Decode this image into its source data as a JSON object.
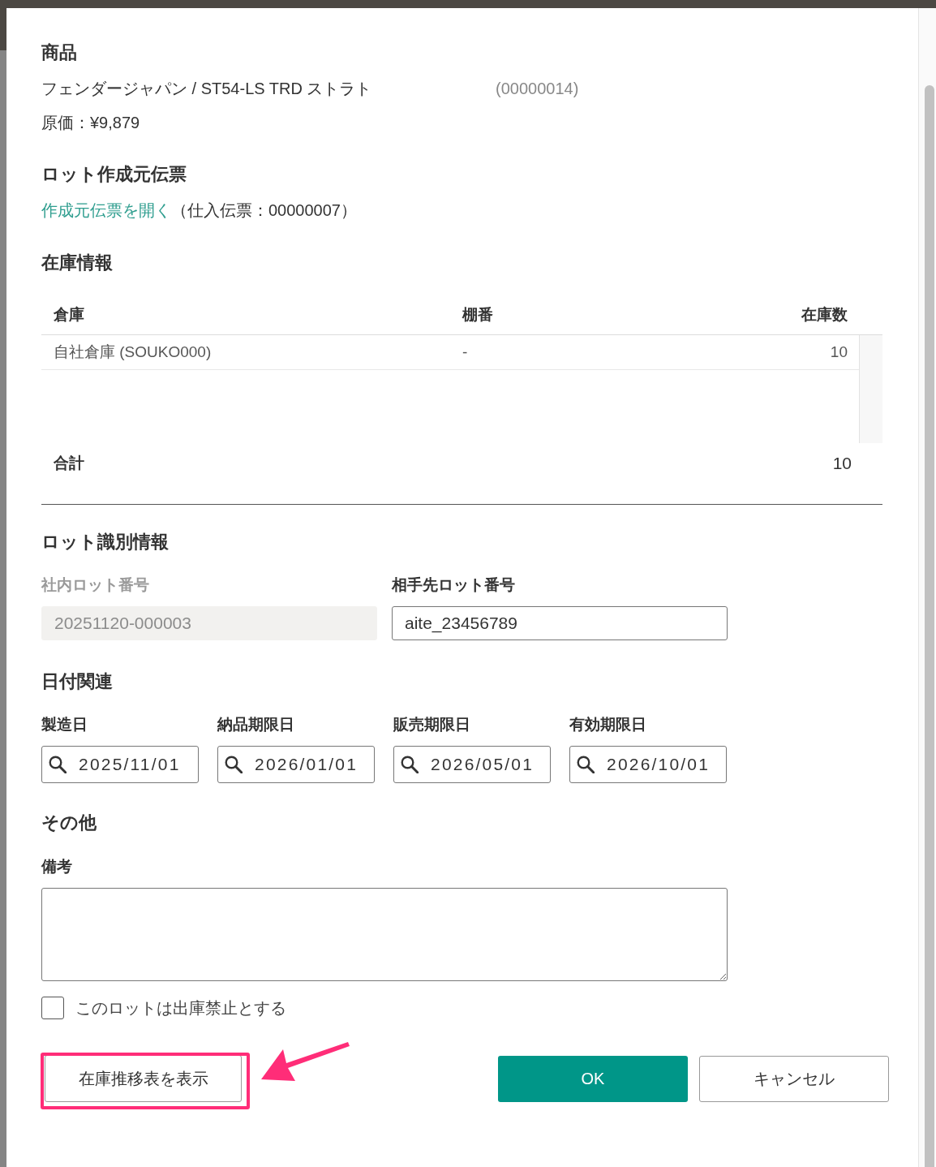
{
  "product": {
    "heading": "商品",
    "name": "フェンダージャパン / ST54-LS TRD ストラト",
    "code": "(00000014)",
    "cost": "原価：¥9,879"
  },
  "source_slip": {
    "heading": "ロット作成元伝票",
    "link": "作成元伝票を開く",
    "detail": "（仕入伝票：00000007）"
  },
  "stock": {
    "heading": "在庫情報",
    "columns": [
      "倉庫",
      "棚番",
      "在庫数"
    ],
    "rows": [
      [
        "自社倉庫 (SOUKO000)",
        "-",
        "10"
      ]
    ],
    "total_label": "合計",
    "total": "10"
  },
  "lot_id": {
    "heading": "ロット識別情報",
    "fields": [
      {
        "label": "社内ロット番号",
        "value": "20251120-000003",
        "disabled": true
      },
      {
        "label": "相手先ロット番号",
        "value": "aite_23456789",
        "disabled": false
      }
    ]
  },
  "dates": {
    "heading": "日付関連",
    "fields": [
      {
        "label": "製造日",
        "value": "2025/11/01"
      },
      {
        "label": "納品期限日",
        "value": "2026/01/01"
      },
      {
        "label": "販売期限日",
        "value": "2026/05/01"
      },
      {
        "label": "有効期限日",
        "value": "2026/10/01"
      }
    ]
  },
  "other": {
    "heading": "その他",
    "remarks": {
      "label": "備考"
    },
    "checkbox": {
      "label": "このロットは出庫禁止とする",
      "checked": false
    }
  },
  "actions": {
    "left": [
      {
        "label": "在庫推移表を表示",
        "kind": "secondary",
        "highlighted": true
      }
    ],
    "right": [
      {
        "label": "OK",
        "kind": "primary",
        "highlighted": false
      },
      {
        "label": "キャンセル",
        "kind": "secondary",
        "highlighted": false
      }
    ]
  }
}
